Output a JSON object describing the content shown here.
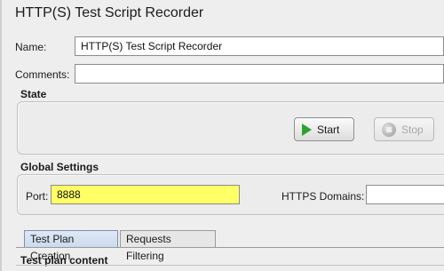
{
  "panel": {
    "title": "HTTP(S) Test Script Recorder"
  },
  "name_row": {
    "label": "Name:",
    "value": "HTTP(S) Test Script Recorder"
  },
  "comments_row": {
    "label": "Comments:",
    "value": ""
  },
  "state": {
    "label": "State",
    "start_label": "Start",
    "stop_label": "Stop"
  },
  "global_settings": {
    "label": "Global Settings",
    "port_label": "Port:",
    "port_value": "8888",
    "https_domains_label": "HTTPS Domains:",
    "https_domains_value": ""
  },
  "tabs": [
    {
      "label": "Test Plan Creation",
      "active": true
    },
    {
      "label": "Requests Filtering",
      "active": false
    }
  ],
  "test_plan_content": {
    "label": "Test plan content"
  },
  "colors": {
    "highlight": "#ffff66",
    "start_icon": "#2fa12f",
    "active_tab": "#c9d9ee"
  },
  "icons": [
    "play-icon",
    "stop-icon"
  ]
}
